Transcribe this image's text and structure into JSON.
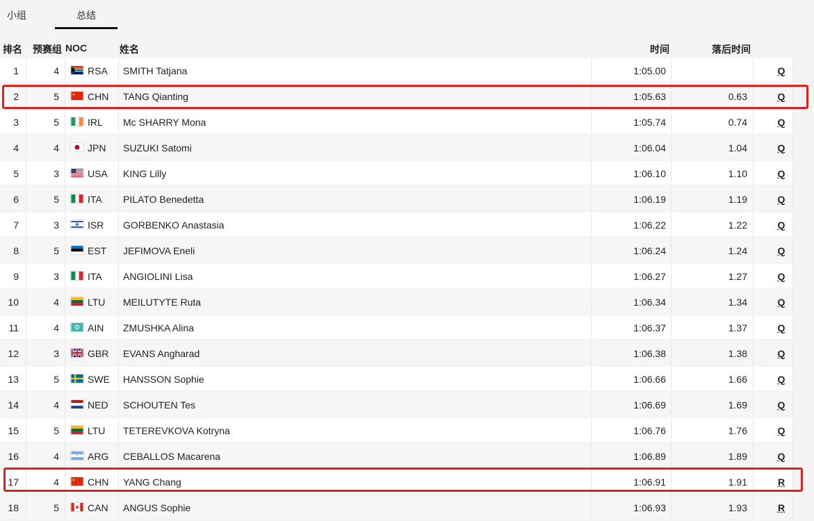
{
  "tabs": [
    {
      "label": "小组"
    },
    {
      "label": "总结"
    }
  ],
  "columns": {
    "rank": "排名",
    "heat": "预赛组",
    "noc": "NOC",
    "name": "姓名",
    "time": "时间",
    "behind": "落后时间"
  },
  "rows": [
    {
      "rank": "1",
      "heat": "4",
      "noc": "RSA",
      "name": "SMITH Tatjana",
      "time": "1:05.00",
      "behind": "",
      "q": "Q"
    },
    {
      "rank": "2",
      "heat": "5",
      "noc": "CHN",
      "name": "TANG Qianting",
      "time": "1:05.63",
      "behind": "0.63",
      "q": "Q"
    },
    {
      "rank": "3",
      "heat": "5",
      "noc": "IRL",
      "name": "Mc SHARRY Mona",
      "time": "1:05.74",
      "behind": "0.74",
      "q": "Q"
    },
    {
      "rank": "4",
      "heat": "4",
      "noc": "JPN",
      "name": "SUZUKI Satomi",
      "time": "1:06.04",
      "behind": "1.04",
      "q": "Q"
    },
    {
      "rank": "5",
      "heat": "3",
      "noc": "USA",
      "name": "KING Lilly",
      "time": "1:06.10",
      "behind": "1.10",
      "q": "Q"
    },
    {
      "rank": "6",
      "heat": "5",
      "noc": "ITA",
      "name": "PILATO Benedetta",
      "time": "1:06.19",
      "behind": "1.19",
      "q": "Q"
    },
    {
      "rank": "7",
      "heat": "3",
      "noc": "ISR",
      "name": "GORBENKO Anastasia",
      "time": "1:06.22",
      "behind": "1.22",
      "q": "Q"
    },
    {
      "rank": "8",
      "heat": "5",
      "noc": "EST",
      "name": "JEFIMOVA Eneli",
      "time": "1:06.24",
      "behind": "1.24",
      "q": "Q"
    },
    {
      "rank": "9",
      "heat": "3",
      "noc": "ITA",
      "name": "ANGIOLINI Lisa",
      "time": "1:06.27",
      "behind": "1.27",
      "q": "Q"
    },
    {
      "rank": "10",
      "heat": "4",
      "noc": "LTU",
      "name": "MEILUTYTE Ruta",
      "time": "1:06.34",
      "behind": "1.34",
      "q": "Q"
    },
    {
      "rank": "11",
      "heat": "4",
      "noc": "AIN",
      "name": "ZMUSHKA Alina",
      "time": "1:06.37",
      "behind": "1.37",
      "q": "Q"
    },
    {
      "rank": "12",
      "heat": "3",
      "noc": "GBR",
      "name": "EVANS Angharad",
      "time": "1:06.38",
      "behind": "1.38",
      "q": "Q"
    },
    {
      "rank": "13",
      "heat": "5",
      "noc": "SWE",
      "name": "HANSSON Sophie",
      "time": "1:06.66",
      "behind": "1.66",
      "q": "Q"
    },
    {
      "rank": "14",
      "heat": "4",
      "noc": "NED",
      "name": "SCHOUTEN Tes",
      "time": "1:06.69",
      "behind": "1.69",
      "q": "Q"
    },
    {
      "rank": "15",
      "heat": "5",
      "noc": "LTU",
      "name": "TETEREVKOVA Kotryna",
      "time": "1:06.76",
      "behind": "1.76",
      "q": "Q"
    },
    {
      "rank": "16",
      "heat": "4",
      "noc": "ARG",
      "name": "CEBALLOS Macarena",
      "time": "1:06.89",
      "behind": "1.89",
      "q": "Q"
    },
    {
      "rank": "17",
      "heat": "4",
      "noc": "CHN",
      "name": "YANG Chang",
      "time": "1:06.91",
      "behind": "1.91",
      "q": "R"
    },
    {
      "rank": "18",
      "heat": "5",
      "noc": "CAN",
      "name": "ANGUS Sophie",
      "time": "1:06.93",
      "behind": "1.93",
      "q": "R"
    }
  ],
  "colors": {
    "highlight": "#e02020",
    "tab_underline": "#111111"
  }
}
